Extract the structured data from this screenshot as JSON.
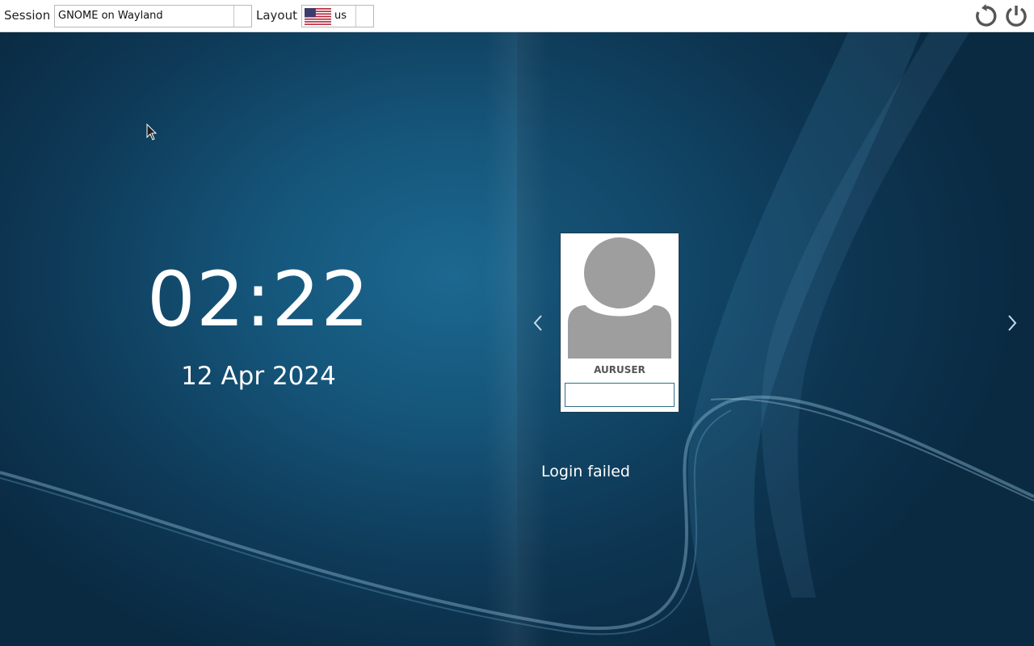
{
  "topbar": {
    "session_label": "Session",
    "session_value": "GNOME on Wayland",
    "layout_label": "Layout",
    "layout_value": "us",
    "layout_flag": "us-flag-icon",
    "reboot_icon": "reboot-icon",
    "shutdown_icon": "power-icon"
  },
  "clock": {
    "time": "02:22",
    "date": "12 Apr 2024"
  },
  "user": {
    "name": "AURUSER",
    "password_value": "",
    "avatar_icon": "user-avatar-icon"
  },
  "navigation": {
    "prev_icon": "chevron-left-icon",
    "next_icon": "chevron-right-icon"
  },
  "status": {
    "message": "Login failed"
  },
  "colors": {
    "topbar_bg": "#ffffff",
    "background_dark": "#0a2a42",
    "background_light": "#1c6890",
    "avatar_gray": "#9e9e9e",
    "text_light": "#ffffff"
  }
}
